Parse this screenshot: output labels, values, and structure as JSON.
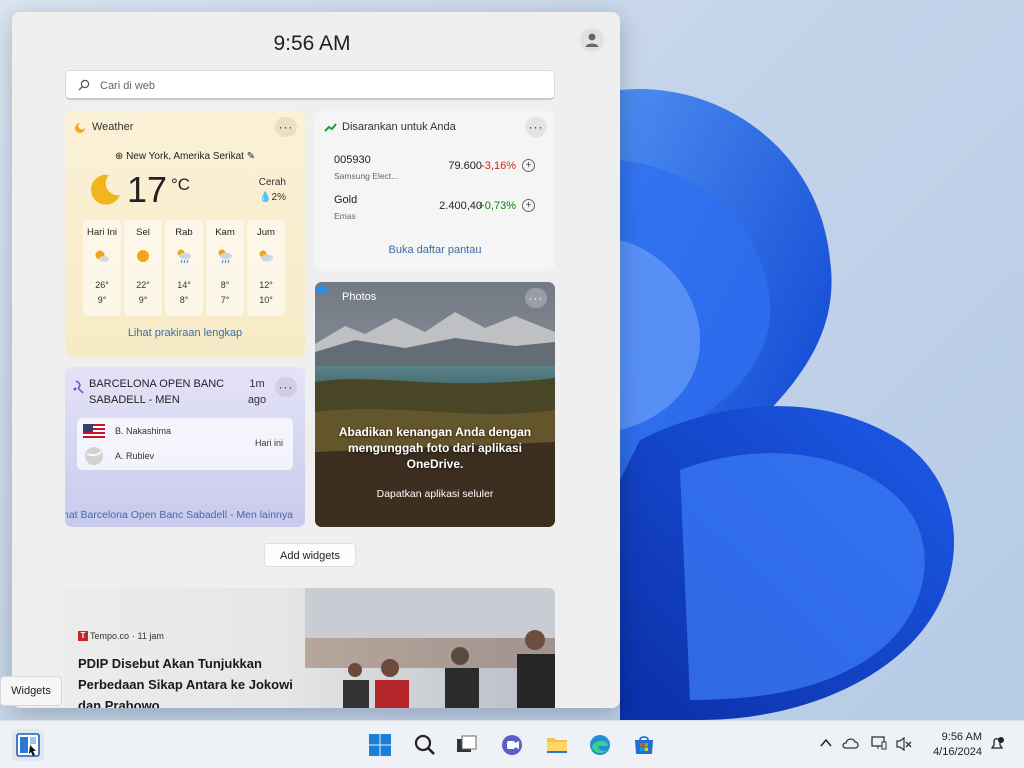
{
  "board": {
    "time": "9:56 AM",
    "search_placeholder": "Cari di web",
    "add_widgets": "Add widgets"
  },
  "weather": {
    "title": "Weather",
    "location": "New York, Amerika Serikat",
    "temp": "17",
    "unit": "°C",
    "condition": "Cerah",
    "precip": "2%",
    "forecast": [
      {
        "day": "Hari Ini",
        "high": "26°",
        "low": "9°",
        "icon": "partly-sunny-icon"
      },
      {
        "day": "Sel",
        "high": "22°",
        "low": "9°",
        "icon": "sunny-icon"
      },
      {
        "day": "Rab",
        "high": "14°",
        "low": "8°",
        "icon": "rain-showers-icon"
      },
      {
        "day": "Kam",
        "high": "8°",
        "low": "7°",
        "icon": "rain-showers-icon"
      },
      {
        "day": "Jum",
        "high": "12°",
        "low": "10°",
        "icon": "cloudy-icon"
      }
    ],
    "link": "Lihat prakiraan lengkap"
  },
  "stocks": {
    "title": "Disarankan untuk Anda",
    "rows": [
      {
        "symbol": "005930",
        "name": "Samsung Elect...",
        "price": "79.600",
        "change": "-3,16%",
        "color": "#c42b1c"
      },
      {
        "symbol": "Gold",
        "name": "Emas",
        "price": "2.400,40",
        "change": "+0,73%",
        "color": "#0f7b0f"
      }
    ],
    "link": "Buka daftar pantau"
  },
  "sports": {
    "title": "BARCELONA OPEN BANC SABADELL - MEN",
    "time": "1m ago",
    "player1": "B. Nakashima",
    "player2": "A. Rublev",
    "when": "Hari ini",
    "link": "hat Barcelona Open Banc Sabadell - Men lainnya"
  },
  "photos": {
    "title": "Photos",
    "message": "Abadikan kenangan Anda dengan mengunggah foto dari aplikasi OneDrive.",
    "link": "Dapatkan aplikasi seluler"
  },
  "news": {
    "source": "Tempo.co",
    "time": "· 11 jam",
    "headline": "PDIP Disebut Akan Tunjukkan Perbedaan Sikap Antara ke Jokowi dan Prabowo"
  },
  "tooltip": "Widgets",
  "taskbar": {
    "time": "9:56 AM",
    "date": "4/16/2024"
  },
  "colors": {
    "accent_link": "#3a6ea8",
    "negative": "#c42b1c",
    "positive": "#0f7b0f"
  }
}
